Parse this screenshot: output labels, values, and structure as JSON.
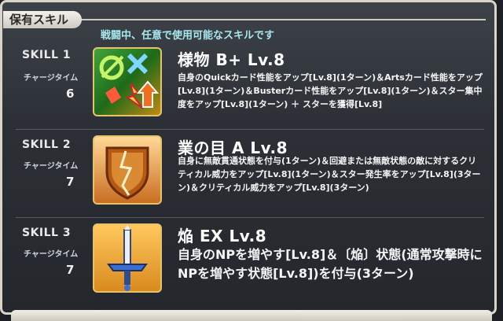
{
  "header": {
    "title": "保有スキル"
  },
  "notice": "戦闘中、任意で使用可能なスキルです",
  "skills": [
    {
      "label": "SKILL 1",
      "ct_label": "チャージタイム",
      "ct": "6",
      "name": "様物 B+ Lv.8",
      "desc": "自身のQuickカード性能をアップ[Lv.8](1ターン)＆Artsカード性能をアップ[Lv.8](1ターン)＆Busterカード性能をアップ[Lv.8](1ターン)＆スター集中度をアップ[Lv.8](1ターン) ＋ スターを獲得[Lv.8]",
      "icon": "buff-cards-icon"
    },
    {
      "label": "SKILL 2",
      "ct_label": "チャージタイム",
      "ct": "7",
      "name": "業の目 A Lv.8",
      "desc": "自身に無敵貫通状態を付与(1ターン)＆回避または無敵状態の敵に対するクリティカル威力をアップ[Lv.8](1ターン)＆スター発生率をアップ[Lv.8](3ターン)＆クリティカル威力をアップ[Lv.8](3ターン)",
      "icon": "cracked-shield-icon"
    },
    {
      "label": "SKILL 3",
      "ct_label": "チャージタイム",
      "ct": "7",
      "name": "焔 EX Lv.8",
      "desc": "自身のNPを増やす[Lv.8]＆〔焔〕状態(通常攻撃時にNPを増やす状態[Lv.8])を付与(3ターン)",
      "icon": "sword-icon"
    }
  ]
}
